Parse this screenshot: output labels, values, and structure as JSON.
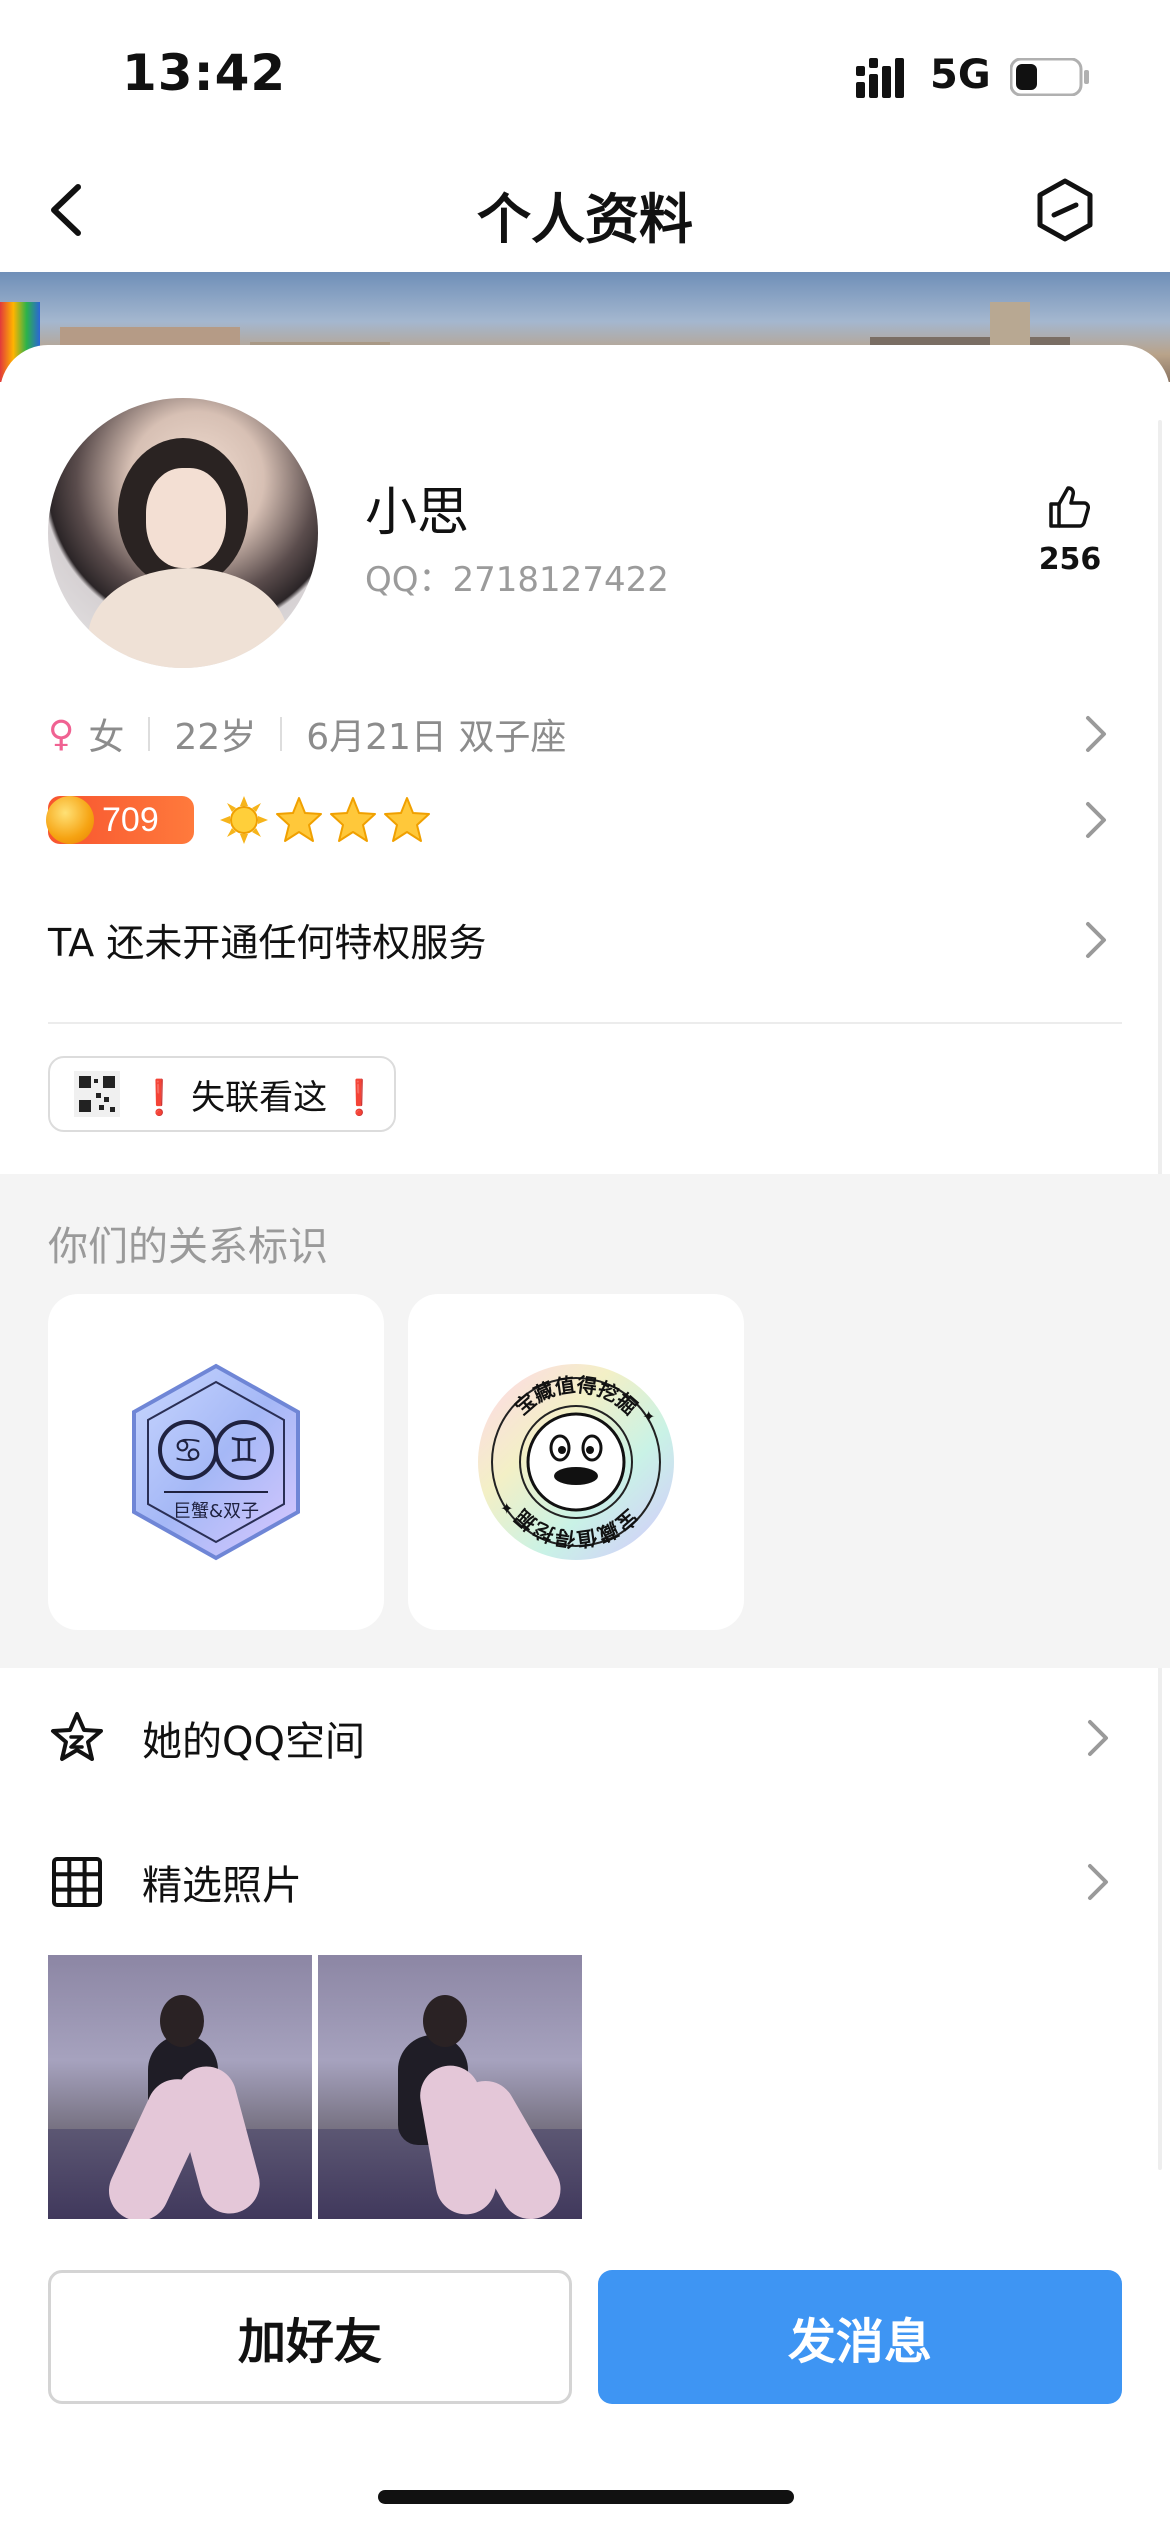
{
  "status_bar": {
    "time": "13:42",
    "network": "5G",
    "battery_level": 0.35
  },
  "nav": {
    "title": "个人资料",
    "back_icon": "chevron-left-icon",
    "more_icon": "hexagon-menu-icon"
  },
  "profile": {
    "nickname": "小思",
    "qq_label": "QQ：2718127422",
    "likes": "256",
    "gender": "女",
    "age": "22岁",
    "birthday_sign": "6月21日 双子座",
    "level_number": "709",
    "level_stars": 3,
    "privilege_text": "TA 还未开通任何特权服务",
    "qr_chip_text": "失联看这"
  },
  "relations": {
    "title": "你们的关系标识",
    "badges": [
      {
        "label": "巨蟹&双子",
        "icon": "zodiac-badge-icon"
      },
      {
        "ring_text": "宝藏值得挖掘",
        "icon": "treasure-badge-icon"
      }
    ]
  },
  "menu": {
    "qzone_label": "她的QQ空间",
    "photos_label": "精选照片"
  },
  "actions": {
    "add_friend": "加好友",
    "send_message": "发消息"
  },
  "colors": {
    "accent": "#3e95f3",
    "level_badge": "#f7542f",
    "gender_female": "#f06292"
  }
}
